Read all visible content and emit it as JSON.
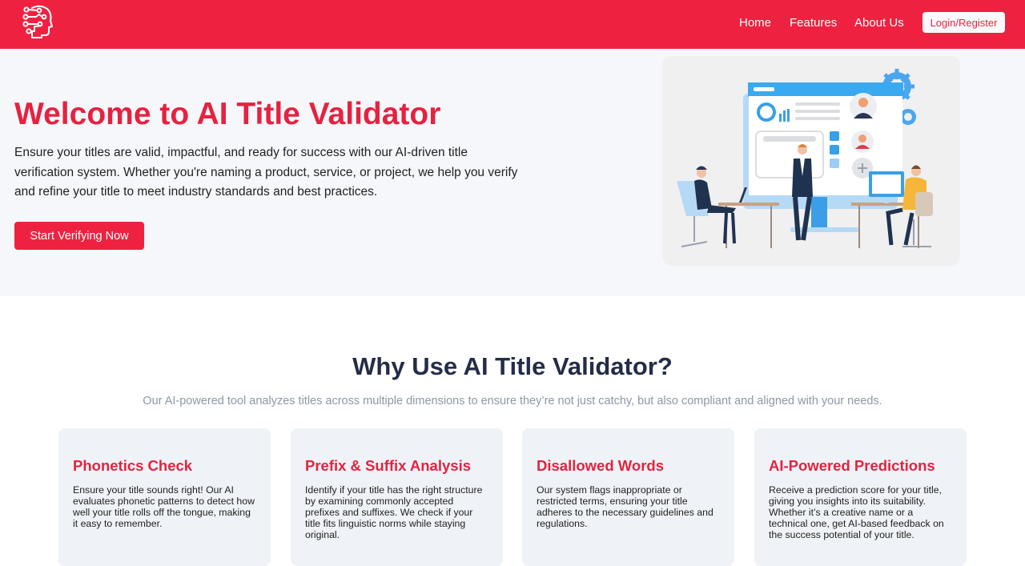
{
  "nav": {
    "links": [
      "Home",
      "Features",
      "About Us"
    ],
    "login_label": "Login/Register"
  },
  "hero": {
    "title": "Welcome to AI Title Validator",
    "description": "Ensure your titles are valid, impactful, and ready for success with our AI-driven title verification system. Whether you're naming a product, service, or project, we help you verify and refine your title to meet industry standards and best practices.",
    "cta_label": "Start Verifying Now"
  },
  "why": {
    "title": "Why Use AI Title Validator?",
    "subtitle": "Our AI-powered tool analyzes titles across multiple dimensions to ensure they’re not just catchy, but also compliant and aligned with your needs.",
    "cards": [
      {
        "title": "Phonetics Check",
        "description": "Ensure your title sounds right! Our AI evaluates phonetic patterns to detect how well your title rolls off the tongue, making it easy to remember."
      },
      {
        "title": "Prefix & Suffix Analysis",
        "description": "Identify if your title has the right structure by examining commonly accepted prefixes and suffixes. We check if your title fits linguistic norms while staying original."
      },
      {
        "title": "Disallowed Words",
        "description": "Our system flags inappropriate or restricted terms, ensuring your title adheres to the necessary guidelines and regulations."
      },
      {
        "title": "AI-Powered Predictions",
        "description": "Receive a prediction score for your title, giving you insights into its suitability. Whether it’s a creative name or a technical one, get AI-based feedback on the success potential of your title."
      }
    ]
  },
  "colors": {
    "brand": "#ee2240",
    "heading_dark": "#242d47",
    "muted": "#8e97a8",
    "hero_bg": "#f6f7fb",
    "card_bg": "#eff2f6"
  },
  "icons": {
    "logo": "ai-head-circuit-logo",
    "illustration": "office-team-dashboard-illustration"
  }
}
